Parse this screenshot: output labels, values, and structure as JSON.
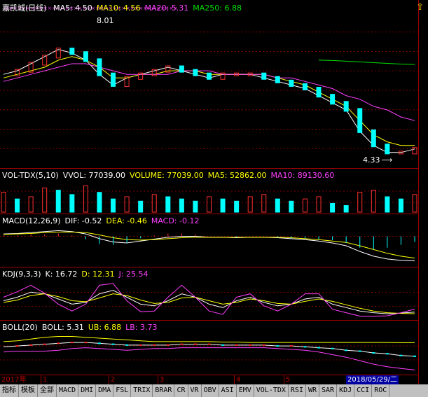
{
  "stock": {
    "name": "嘉凯城",
    "period": "(日线)"
  },
  "main_legend": [
    {
      "label": "MA5: 4.50",
      "color": "#ffffff"
    },
    {
      "label": "MA10: 4.56",
      "color": "#ffff00"
    },
    {
      "label": "MA20: 5.31",
      "color": "#ff40ff"
    },
    {
      "label": "MA250: 6.88",
      "color": "#00e000"
    }
  ],
  "price_markers": {
    "high": "8.01",
    "low": "4.33"
  },
  "vol_legend": [
    {
      "label": "VOL-TDX(5,10)",
      "color": "#ffffff"
    },
    {
      "label": "VVOL: 77039.00",
      "color": "#ffffff"
    },
    {
      "label": "VOLUME: 77039.00",
      "color": "#ffff00"
    },
    {
      "label": "MA5: 52862.00",
      "color": "#ffff00"
    },
    {
      "label": "MA10: 89130.60",
      "color": "#ff40ff"
    }
  ],
  "macd_legend": [
    {
      "label": "MACD(12,26,9)",
      "color": "#ffffff"
    },
    {
      "label": "DIF: -0.52",
      "color": "#ffffff"
    },
    {
      "label": "DEA: -0.46",
      "color": "#ffff00"
    },
    {
      "label": "MACD: -0.12",
      "color": "#ff40ff"
    }
  ],
  "kdj_legend": [
    {
      "label": "KDJ(9,3,3)",
      "color": "#ffffff"
    },
    {
      "label": "K: 16.72",
      "color": "#ffffff"
    },
    {
      "label": "D: 12.31",
      "color": "#ffff00"
    },
    {
      "label": "J: 25.54",
      "color": "#ff40ff"
    }
  ],
  "boll_legend": [
    {
      "label": "BOLL(20)",
      "color": "#ffffff"
    },
    {
      "label": "BOLL: 5.31",
      "color": "#ffffff"
    },
    {
      "label": "UB: 6.88",
      "color": "#ffff00"
    },
    {
      "label": "LB: 3.73",
      "color": "#ff40ff"
    }
  ],
  "time_axis": {
    "year": "2017年",
    "months": [
      "1",
      "2",
      "3",
      "4",
      "5"
    ],
    "current_date": "2018/05/29/二"
  },
  "tabs": [
    "指标",
    "模板",
    "全部",
    "MACD",
    "DMI",
    "DMA",
    "FSL",
    "TRIX",
    "BRAR",
    "CR",
    "VR",
    "OBV",
    "ASI",
    "EMV",
    "VOL-TDX",
    "RSI",
    "WR",
    "SAR",
    "KDJ",
    "CCI",
    "ROC"
  ],
  "colors": {
    "up": "#ff3030",
    "down": "#00ffff",
    "border": "#a00000"
  },
  "icons": {
    "scroll": "scroll-arrow-icon"
  },
  "chart_data": [
    {
      "type": "candlestick",
      "title": "",
      "series": [
        {
          "name": "MA5",
          "values": [
            6.6,
            6.7,
            6.9,
            7.1,
            7.3,
            7.2,
            7.0,
            6.6,
            6.3,
            6.5,
            6.6,
            6.7,
            6.8,
            6.7,
            6.6,
            6.5,
            6.6,
            6.6,
            6.6,
            6.5,
            6.4,
            6.3,
            6.2,
            6.0,
            5.8,
            5.6,
            5.0,
            4.6,
            4.4,
            4.4,
            4.5
          ]
        },
        {
          "name": "MA10",
          "values": [
            6.5,
            6.6,
            6.7,
            6.8,
            7.0,
            7.1,
            7.0,
            6.8,
            6.5,
            6.5,
            6.6,
            6.6,
            6.7,
            6.7,
            6.7,
            6.6,
            6.6,
            6.6,
            6.6,
            6.6,
            6.5,
            6.4,
            6.3,
            6.1,
            5.9,
            5.7,
            5.3,
            4.9,
            4.7,
            4.6,
            4.6
          ]
        },
        {
          "name": "MA20",
          "values": [
            6.4,
            6.5,
            6.6,
            6.7,
            6.8,
            6.9,
            6.9,
            6.8,
            6.7,
            6.6,
            6.6,
            6.6,
            6.6,
            6.7,
            6.7,
            6.7,
            6.6,
            6.6,
            6.6,
            6.6,
            6.5,
            6.5,
            6.4,
            6.3,
            6.2,
            6.0,
            5.9,
            5.7,
            5.6,
            5.4,
            5.3
          ]
        },
        {
          "name": "MA250",
          "values": [
            null,
            null,
            null,
            null,
            null,
            null,
            null,
            null,
            null,
            null,
            null,
            null,
            null,
            null,
            null,
            null,
            null,
            null,
            null,
            null,
            null,
            null,
            null,
            7.0,
            6.99,
            6.97,
            6.95,
            6.93,
            6.91,
            6.89,
            6.88
          ]
        }
      ],
      "annotations": [
        "8.01",
        "4.33"
      ]
    },
    {
      "type": "bar",
      "title": "",
      "series": [
        {
          "name": "VOLUME",
          "values": [
            9,
            6,
            7,
            11,
            10,
            8,
            12,
            9,
            6,
            7,
            5,
            8,
            7,
            6,
            5,
            7,
            6,
            5,
            7,
            8,
            6,
            5,
            6,
            7,
            4,
            3,
            9,
            10,
            7,
            6,
            8
          ]
        }
      ]
    },
    {
      "type": "line",
      "title": "",
      "series": [
        {
          "name": "DIF",
          "values": [
            0.05,
            0.06,
            0.08,
            0.1,
            0.12,
            0.1,
            0.05,
            -0.05,
            -0.12,
            -0.14,
            -0.1,
            -0.06,
            -0.02,
            0.0,
            0.0,
            -0.02,
            -0.02,
            -0.03,
            -0.02,
            -0.02,
            -0.03,
            -0.05,
            -0.07,
            -0.1,
            -0.14,
            -0.2,
            -0.32,
            -0.42,
            -0.48,
            -0.51,
            -0.52
          ]
        },
        {
          "name": "DEA",
          "values": [
            0.04,
            0.05,
            0.06,
            0.08,
            0.09,
            0.09,
            0.08,
            0.03,
            -0.03,
            -0.07,
            -0.08,
            -0.07,
            -0.05,
            -0.03,
            -0.02,
            -0.02,
            -0.02,
            -0.02,
            -0.02,
            -0.02,
            -0.02,
            -0.03,
            -0.05,
            -0.07,
            -0.1,
            -0.13,
            -0.2,
            -0.28,
            -0.36,
            -0.42,
            -0.46
          ]
        }
      ]
    },
    {
      "type": "line",
      "title": "",
      "series": [
        {
          "name": "K",
          "values": [
            50,
            60,
            75,
            70,
            55,
            40,
            45,
            70,
            80,
            60,
            40,
            35,
            50,
            70,
            60,
            40,
            30,
            50,
            60,
            45,
            35,
            40,
            55,
            60,
            40,
            30,
            20,
            15,
            12,
            14,
            16.72
          ]
        },
        {
          "name": "D",
          "values": [
            45,
            52,
            65,
            70,
            62,
            50,
            47,
            58,
            70,
            65,
            52,
            42,
            45,
            58,
            60,
            50,
            40,
            45,
            55,
            50,
            42,
            40,
            48,
            55,
            48,
            38,
            28,
            20,
            15,
            13,
            12.31
          ]
        },
        {
          "name": "J",
          "values": [
            60,
            76,
            95,
            72,
            40,
            20,
            40,
            95,
            100,
            50,
            18,
            20,
            60,
            95,
            60,
            20,
            10,
            60,
            70,
            35,
            20,
            40,
            70,
            70,
            25,
            15,
            5,
            5,
            6,
            15,
            25.54
          ]
        }
      ]
    },
    {
      "type": "line",
      "title": "",
      "series": [
        {
          "name": "BOLL",
          "values": [
            6.4,
            6.5,
            6.6,
            6.7,
            6.8,
            6.9,
            6.9,
            6.8,
            6.7,
            6.6,
            6.6,
            6.6,
            6.6,
            6.7,
            6.7,
            6.7,
            6.6,
            6.6,
            6.6,
            6.6,
            6.5,
            6.5,
            6.4,
            6.3,
            6.2,
            6.0,
            5.9,
            5.7,
            5.6,
            5.4,
            5.31
          ]
        },
        {
          "name": "UB",
          "values": [
            7.0,
            7.1,
            7.3,
            7.5,
            7.6,
            7.6,
            7.5,
            7.4,
            7.3,
            7.2,
            7.1,
            7.0,
            7.0,
            7.0,
            7.0,
            7.0,
            6.95,
            6.95,
            6.9,
            6.9,
            6.9,
            6.9,
            6.9,
            6.9,
            6.9,
            6.9,
            6.9,
            6.9,
            6.9,
            6.88,
            6.88
          ]
        },
        {
          "name": "LB",
          "values": [
            5.8,
            5.9,
            5.9,
            5.9,
            6.0,
            6.2,
            6.3,
            6.2,
            6.1,
            6.0,
            6.1,
            6.2,
            6.2,
            6.3,
            6.3,
            6.3,
            6.3,
            6.3,
            6.3,
            6.3,
            6.2,
            6.1,
            6.0,
            5.8,
            5.5,
            5.2,
            4.8,
            4.4,
            4.1,
            3.9,
            3.73
          ]
        }
      ]
    }
  ]
}
